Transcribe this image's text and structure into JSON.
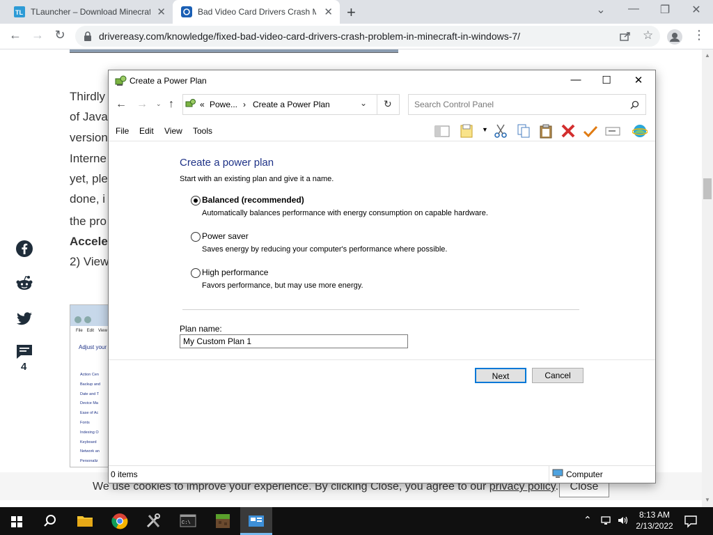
{
  "browser": {
    "tabs": [
      {
        "title": "TLauncher – Download Minecraft",
        "favicon": "TL"
      },
      {
        "title": "Bad Video Card Drivers Crash M"
      }
    ],
    "url": "drivereasy.com/knowledge/fixed-bad-video-card-drivers-crash-problem-in-minecraft-in-windows-7/"
  },
  "article": {
    "lines": [
      "Thirdly",
      "of Java",
      "version",
      "Interne",
      "yet, ple",
      "done, i",
      "the pro",
      "Accele",
      "2) View"
    ],
    "comment_count": "4",
    "thumb_menu": [
      "File",
      "Edit",
      "View"
    ],
    "thumb_heading": "Adjust your",
    "thumb_items": [
      "Action Cen",
      "Backup and",
      "Date and T",
      "Device Ma",
      "Ease of Ac",
      "Fonts",
      "Indexing O",
      "Keyboard",
      "Network an",
      "Personaliz"
    ]
  },
  "dialog": {
    "title": "Create a Power Plan",
    "breadcrumb": {
      "prefix": "«",
      "parent": "Powe...",
      "sep": "›",
      "current": "Create a Power Plan"
    },
    "search_placeholder": "Search Control Panel",
    "menu": [
      "File",
      "Edit",
      "View",
      "Tools"
    ],
    "heading": "Create a power plan",
    "subheading": "Start with an existing plan and give it a name.",
    "options": [
      {
        "label": "Balanced (recommended)",
        "desc": "Automatically balances performance with energy consumption on capable hardware.",
        "selected": true
      },
      {
        "label": "Power saver",
        "desc": "Saves energy by reducing your computer's performance where possible.",
        "selected": false
      },
      {
        "label": "High performance",
        "desc": "Favors performance, but may use more energy.",
        "selected": false
      }
    ],
    "plan_name_label": "Plan name:",
    "plan_name_value": "My Custom Plan 1",
    "next_label": "Next",
    "cancel_label": "Cancel",
    "status_items": "0 items",
    "status_location": "Computer"
  },
  "cookie": {
    "text": "We use cookies to improve your experience. By clicking Close, you agree to our",
    "link": "privacy policy",
    "period": ".",
    "close": "Close"
  },
  "taskbar": {
    "time": "8:13 AM",
    "date": "2/13/2022"
  },
  "colors": {
    "heading": "#1e3287",
    "accent": "#0078d7",
    "taskbar": "#101010"
  }
}
